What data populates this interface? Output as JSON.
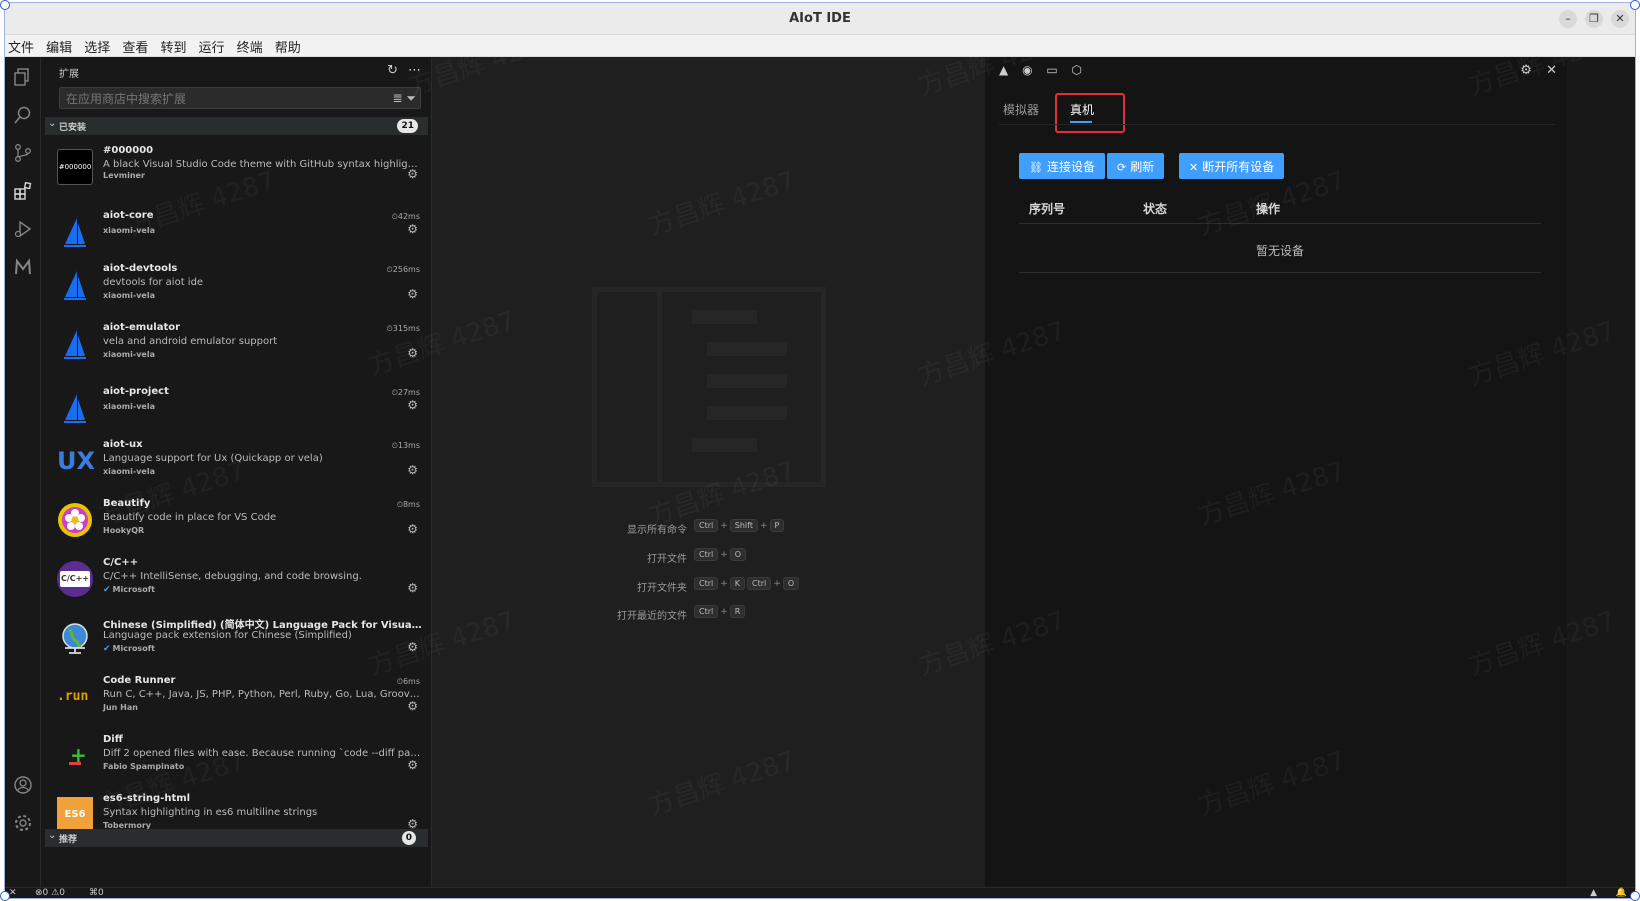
{
  "window": {
    "title": "AIoT IDE"
  },
  "menu": [
    "文件",
    "编辑",
    "选择",
    "查看",
    "转到",
    "运行",
    "终端",
    "帮助"
  ],
  "sidebar": {
    "header": "扩展",
    "search_placeholder": "在应用商店中搜索扩展",
    "installed_label": "已安装",
    "installed_count": "21",
    "recommended_label": "推荐",
    "recommended_count": "0",
    "extensions": [
      {
        "name": "#000000",
        "desc": "A black Visual Studio Code theme with GitHub syntax highlighti...",
        "publisher": "Levminer",
        "time": "",
        "icon_text": "#000000"
      },
      {
        "name": "aiot-core",
        "desc": "",
        "publisher": "xiaomi-vela",
        "time": "42ms",
        "icon_text": ""
      },
      {
        "name": "aiot-devtools",
        "desc": "devtools for aiot ide",
        "publisher": "xiaomi-vela",
        "time": "256ms",
        "icon_text": ""
      },
      {
        "name": "aiot-emulator",
        "desc": "vela and android emulator support",
        "publisher": "xiaomi-vela",
        "time": "315ms",
        "icon_text": ""
      },
      {
        "name": "aiot-project",
        "desc": "",
        "publisher": "xiaomi-vela",
        "time": "27ms",
        "icon_text": ""
      },
      {
        "name": "aiot-ux",
        "desc": "Language support for Ux (Quickapp or vela)",
        "publisher": "xiaomi-vela",
        "time": "13ms",
        "icon_text": "UX"
      },
      {
        "name": "Beautify",
        "desc": "Beautify code in place for VS Code",
        "publisher": "HookyQR",
        "time": "8ms",
        "icon_text": ""
      },
      {
        "name": "C/C++",
        "desc": "C/C++ IntelliSense, debugging, and code browsing.",
        "publisher": "Microsoft",
        "time": "",
        "icon_text": "C/C++"
      },
      {
        "name": "Chinese (Simplified) (简体中文) Language Pack for Visual Stu...",
        "desc": "Language pack extension for Chinese (Simplified)",
        "publisher": "Microsoft",
        "time": "",
        "icon_text": ""
      },
      {
        "name": "Code Runner",
        "desc": "Run C, C++, Java, JS, PHP, Python, Perl, Ruby, Go, Lua, Groovy, P...",
        "publisher": "Jun Han",
        "time": "6ms",
        "icon_text": ".run"
      },
      {
        "name": "Diff",
        "desc": "Diff 2 opened files with ease. Because running `code --diff path1...",
        "publisher": "Fabio Spampinato",
        "time": "",
        "icon_text": ""
      },
      {
        "name": "es6-string-html",
        "desc": "Syntax highlighting in es6 multiline strings",
        "publisher": "Tobermory",
        "time": "",
        "icon_text": "ES6"
      }
    ]
  },
  "editor": {
    "shortcuts": [
      {
        "label": "显示所有命令",
        "keys": [
          "Ctrl",
          "+",
          "Shift",
          "+",
          "P"
        ]
      },
      {
        "label": "打开文件",
        "keys": [
          "Ctrl",
          "+",
          "O"
        ]
      },
      {
        "label": "打开文件夹",
        "keys": [
          "Ctrl",
          "+",
          "K",
          "Ctrl",
          "+",
          "O"
        ]
      },
      {
        "label": "打开最近的文件",
        "keys": [
          "Ctrl",
          "+",
          "R"
        ]
      }
    ]
  },
  "panel": {
    "tab_simulator": "模拟器",
    "tab_device": "真机",
    "btn_connect": "连接设备",
    "btn_refresh": "刷新",
    "btn_disconnect": "断开所有设备",
    "col_serial": "序列号",
    "col_status": "状态",
    "col_action": "操作",
    "empty_text": "暂无设备"
  },
  "statusbar": {
    "errors": "0",
    "warnings": "0",
    "ports": "0"
  },
  "watermark": "方昌辉 4287",
  "colors": {
    "accent": "#409eff",
    "highlight": "#e0303a",
    "vela_blue": "#1a6cf0"
  }
}
